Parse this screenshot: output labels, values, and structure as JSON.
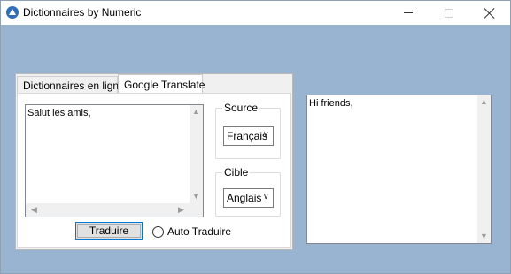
{
  "window": {
    "title": "Dictionnaires by Numeric",
    "app_icon": "app-icon",
    "controls": {
      "minimize": "minimize-icon",
      "maximize": "maximize-icon",
      "close": "close-icon"
    }
  },
  "tabs": [
    {
      "label": "Dictionnaires en ligne",
      "active": false
    },
    {
      "label": "Google Translate",
      "active": true
    }
  ],
  "source_text": "Salut les amis,",
  "source_group": {
    "label": "Source",
    "selected": "Français"
  },
  "target_group": {
    "label": "Cible",
    "selected": "Anglais"
  },
  "translate_button": "Traduire",
  "auto_translate": {
    "label": "Auto Traduire",
    "checked": false
  },
  "result_text": "Hi friends,",
  "colors": {
    "background": "#99b4d1",
    "accent": "#0078d7"
  }
}
